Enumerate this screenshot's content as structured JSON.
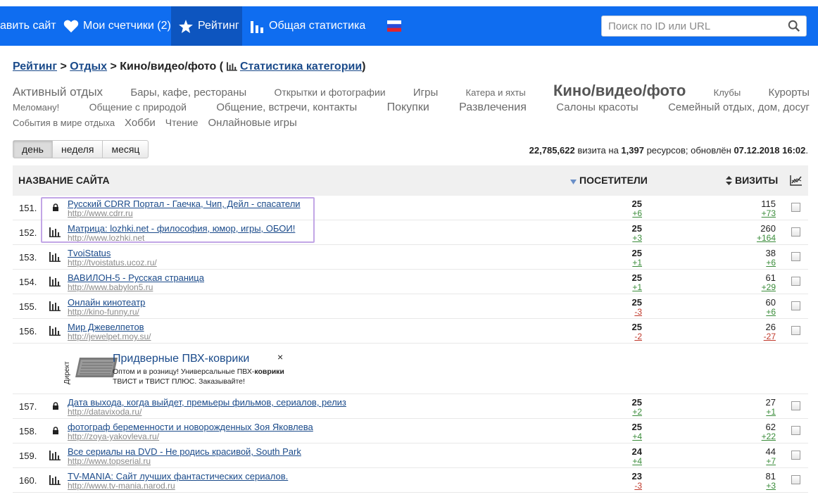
{
  "nav": {
    "add_site": "авить сайт",
    "my_counters": "Мои счетчики (2)",
    "rating": "Рейтинг",
    "stats": "Общая статистика",
    "search_placeholder": "Поиск по ID или URL"
  },
  "breadcrumb": {
    "rating": "Рейтинг",
    "sep1": " > ",
    "rest": "Отдых",
    "sep2": " > ",
    "current": "Кино/видео/фото (",
    "cat_stats": "Статистика категории",
    "close": ")"
  },
  "categories": {
    "line1": [
      {
        "label": "Активный отдых",
        "size": 17
      },
      {
        "label": "Бары, кафе, рестораны",
        "size": 15
      },
      {
        "label": "Открытки и фотографии",
        "size": 14
      },
      {
        "label": "Игры",
        "size": 15
      },
      {
        "label": "Катера и яхты",
        "size": 13
      },
      {
        "label": "Кино/видео/фото",
        "size": 22
      },
      {
        "label": "Клубы",
        "size": 13
      },
      {
        "label": "Курорты",
        "size": 15
      }
    ],
    "line2": [
      {
        "label": "Меломану!",
        "size": 13
      },
      {
        "label": "Общение с природой",
        "size": 14
      },
      {
        "label": "Общение, встречи, контакты",
        "size": 15
      },
      {
        "label": "Покупки",
        "size": 16
      },
      {
        "label": "Развлечения",
        "size": 16
      },
      {
        "label": "Салоны красоты",
        "size": 15
      },
      {
        "label": "Семейный отдых, дом, досуг",
        "size": 15
      }
    ],
    "line3": [
      {
        "label": "События в мире отдыха",
        "size": 13
      },
      {
        "label": "Хобби",
        "size": 15
      },
      {
        "label": "Чтение",
        "size": 14
      },
      {
        "label": "Онлайновые игры",
        "size": 15
      }
    ]
  },
  "periods": [
    "день",
    "неделя",
    "месяц"
  ],
  "summary": {
    "visits": "22,785,622",
    "t1": " визита на ",
    "resources": "1,397",
    "t2": " ресурсов; обновлён ",
    "updated": "07.12.2018 16:02",
    "t3": "."
  },
  "table": {
    "col_name": "НАЗВАНИЕ САЙТА",
    "col_visitors": "ПОСЕТИТЕЛИ",
    "col_visits": "ВИЗИТЫ"
  },
  "rows_a": [
    {
      "num": "151.",
      "icon": "lock-icon",
      "title": "Русский CDRR Портал - Гаечка, Чип, Дейл - спасатели",
      "url": "http://www.cdrr.ru",
      "visitors": "25",
      "visitors_delta": "+6",
      "visits": "115",
      "visits_delta": "+73"
    },
    {
      "num": "152.",
      "icon": "bar-chart-icon",
      "title": "Матрица: lozhki.net - философия, юмор, игры, ОБОИ!",
      "url": "http://www.lozhki.net",
      "visitors": "25",
      "visitors_delta": "+3",
      "visits": "260",
      "visits_delta": "+164"
    },
    {
      "num": "153.",
      "icon": "bar-chart-icon",
      "title": "TvoiStatus",
      "url": "http://tvoistatus.ucoz.ru/",
      "visitors": "25",
      "visitors_delta": "+1",
      "visits": "38",
      "visits_delta": "+6"
    },
    {
      "num": "154.",
      "icon": "bar-chart-icon",
      "title": "ВАВИЛОН-5 - Русская страница",
      "url": "http://www.babylon5.ru",
      "visitors": "25",
      "visitors_delta": "+1",
      "visits": "61",
      "visits_delta": "+29"
    },
    {
      "num": "155.",
      "icon": "bar-chart-icon",
      "title": "Онлайн кинотеатр",
      "url": "http://kino-funny.ru/",
      "visitors": "25",
      "visitors_delta": "-3",
      "visits": "60",
      "visits_delta": "+6"
    },
    {
      "num": "156.",
      "icon": "bar-chart-icon",
      "title": "Мир Джевелпетов",
      "url": "http://jewelpet.moy.su/",
      "visitors": "25",
      "visitors_delta": "-2",
      "visits": "26",
      "visits_delta": "-27"
    }
  ],
  "ad": {
    "direct": "Директ",
    "title": "Придверные ПВХ-коврики",
    "text1": "Оптом и в розницу! Универсальные ПВХ-",
    "text_bold": "коврики",
    "text2": " ТВИСТ и ТВИСТ ПЛЮС. Заказывайте!",
    "close": "×"
  },
  "rows_b": [
    {
      "num": "157.",
      "icon": "lock-icon",
      "title": "Дата выхода, когда выйдет, премьеры фильмов, сериалов, релиз",
      "url": "http://datavixoda.ru/",
      "visitors": "25",
      "visitors_delta": "+2",
      "visits": "27",
      "visits_delta": "+1"
    },
    {
      "num": "158.",
      "icon": "lock-icon",
      "title": "фотограф беременности и новорожденных Зоя Яковлева",
      "url": "http://zoya-yakovleva.ru/",
      "visitors": "25",
      "visitors_delta": "+4",
      "visits": "62",
      "visits_delta": "+22"
    },
    {
      "num": "159.",
      "icon": "bar-chart-icon",
      "title": "Все сериалы на DVD - Не родись красивой, South Park",
      "url": "http://www.topserial.ru",
      "visitors": "24",
      "visitors_delta": "+4",
      "visits": "44",
      "visits_delta": "+7"
    },
    {
      "num": "160.",
      "icon": "bar-chart-icon",
      "title": "TV-MANIA: Сайт лучших фантастических сериалов.",
      "url": "http://www.tv-mania.narod.ru",
      "visitors": "23",
      "visitors_delta": "-3",
      "visits": "81",
      "visits_delta": "+3"
    }
  ]
}
